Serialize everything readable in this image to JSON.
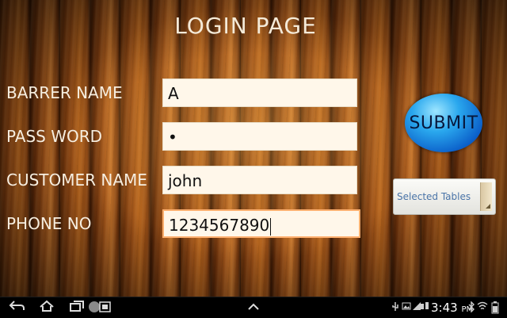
{
  "title": "LOGIN PAGE",
  "fields": {
    "barrer_name": {
      "label": "BARRER NAME",
      "value": "A"
    },
    "password": {
      "label": "PASS WORD",
      "value": "•"
    },
    "customer_name": {
      "label": "CUSTOMER NAME",
      "value": "john"
    },
    "phone": {
      "label": "PHONE NO",
      "value": "1234567890"
    }
  },
  "submit_label": "SUBMIT",
  "spinner": {
    "selected": "Selected Tables"
  },
  "statusbar": {
    "time": "3:43",
    "ampm": "PM"
  },
  "icons": {
    "back": "back-arrow-icon",
    "home": "home-icon",
    "recent": "recent-apps-icon",
    "screenshot": "screenshot-icon",
    "up": "chevron-up-icon",
    "usb": "usb-icon",
    "gallery": "image-icon",
    "wifi": "wifi-icon",
    "bluetooth": "bluetooth-icon",
    "battery": "battery-icon"
  },
  "colors": {
    "submit": "#0b5fc9",
    "title": "#f4ead8",
    "focus_border": "#ffb070"
  }
}
